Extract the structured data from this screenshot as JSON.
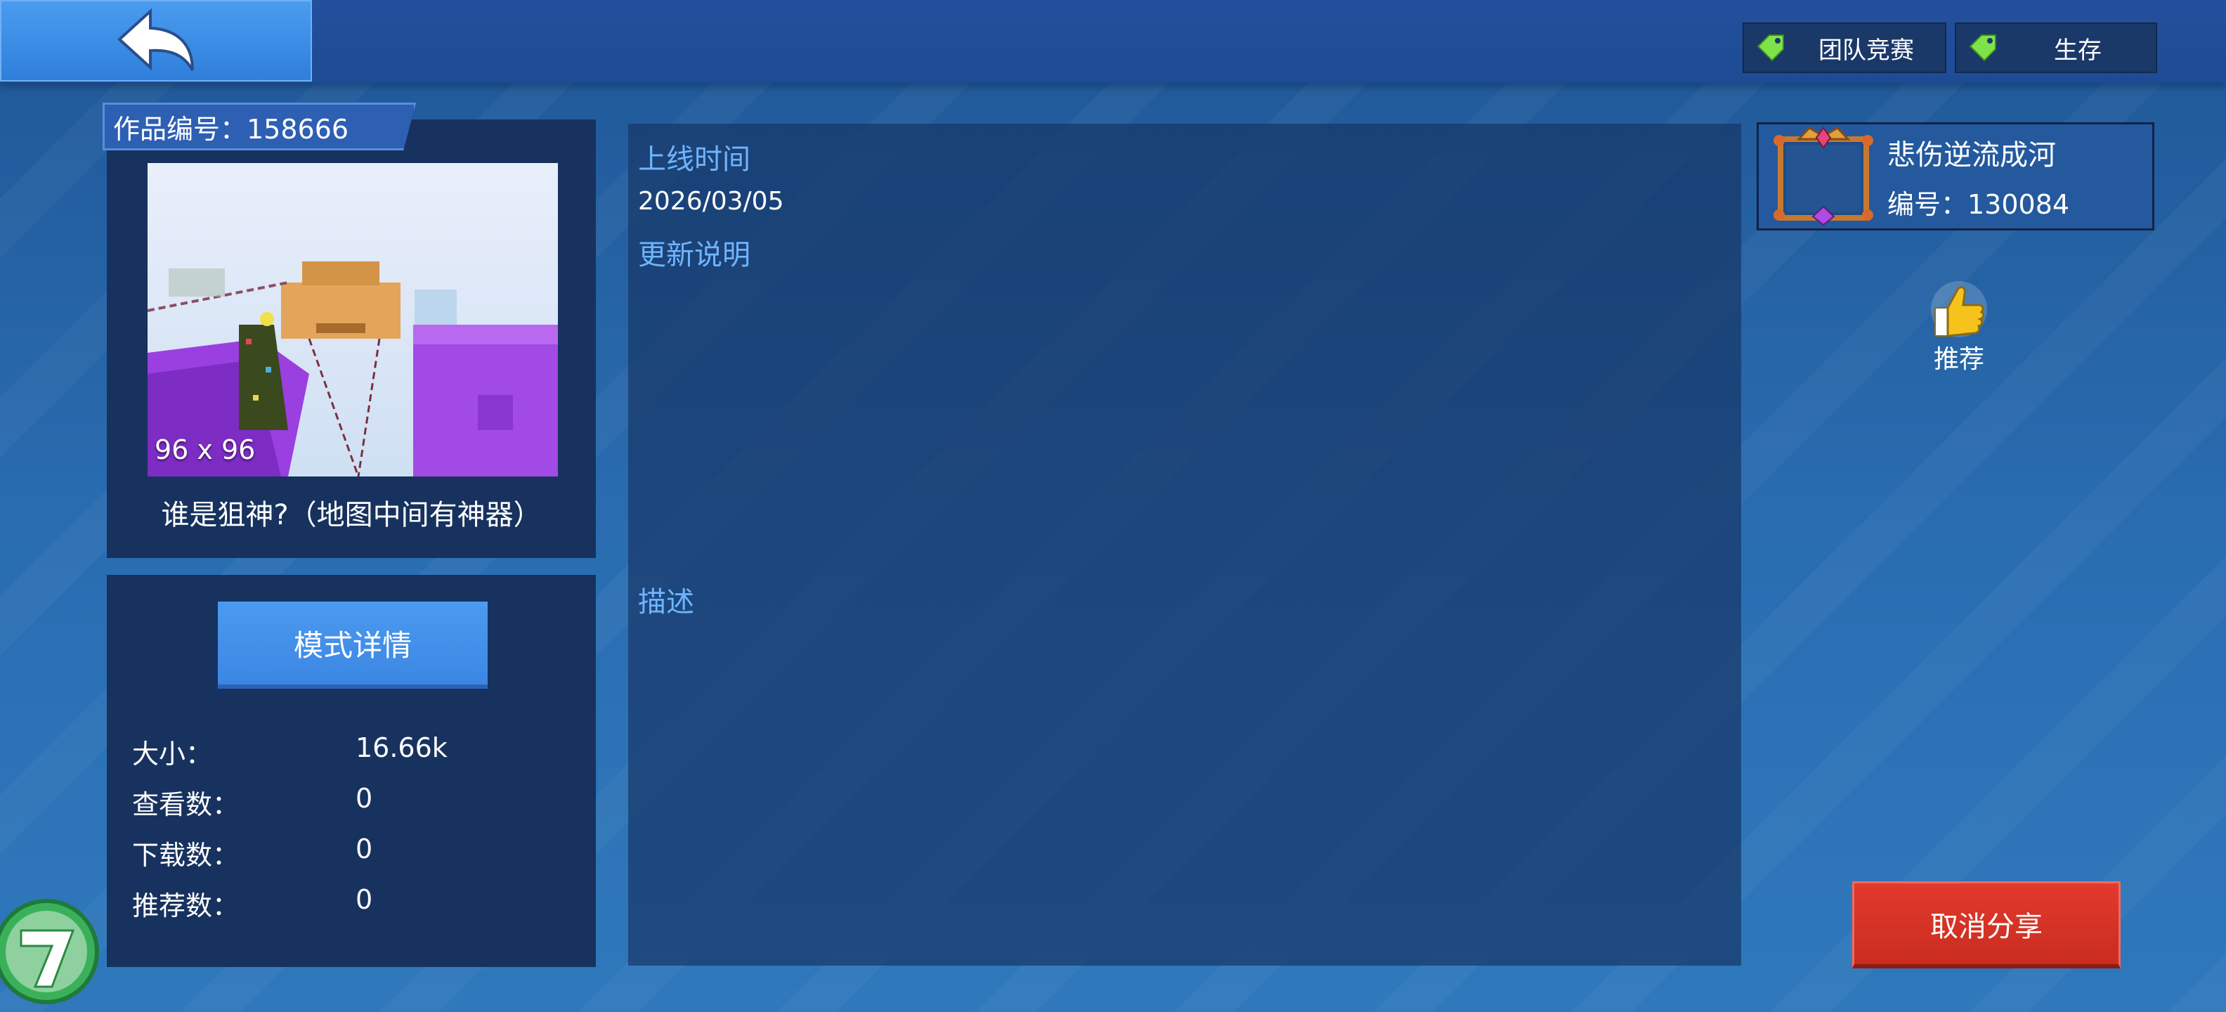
{
  "tags": [
    {
      "label": "团队竞赛",
      "icon": "tag-icon"
    },
    {
      "label": "生存",
      "icon": "tag-icon"
    }
  ],
  "work": {
    "id_label": "作品编号：158666",
    "size_label": "96 x 96",
    "title": "谁是狙神?（地图中间有神器）"
  },
  "mode_button": "模式详情",
  "stats": [
    {
      "key": "大小：",
      "value": "16.66k"
    },
    {
      "key": "查看数：",
      "value": "0"
    },
    {
      "key": "下载数：",
      "value": "0"
    },
    {
      "key": "推荐数：",
      "value": "0"
    }
  ],
  "info": {
    "online_label": "上线时间",
    "online_date": "2026/03/05",
    "update_label": "更新说明",
    "desc_label": "描述"
  },
  "author": {
    "name": "悲伤逆流成河",
    "id_label": "编号：130084"
  },
  "recommend_label": "推荐",
  "cancel_share": "取消分享",
  "colors": {
    "accent_blue": "#3b86e3",
    "cancel_red": "#d8342a",
    "label_blue": "#6fb4ff",
    "tag_green": "#7ee34a"
  }
}
